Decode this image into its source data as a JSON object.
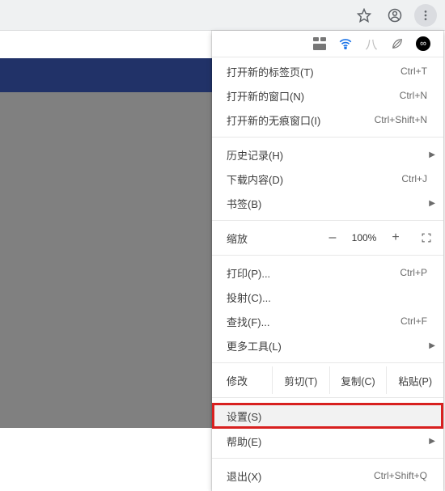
{
  "toolbar": {
    "icons": {
      "star": "star-icon",
      "account": "account-icon",
      "menu": "menu-icon"
    }
  },
  "extension_icons": [
    "apps",
    "wifi",
    "brush",
    "leaf",
    "infinity"
  ],
  "menu": {
    "group1": [
      {
        "label": "打开新的标签页(T)",
        "shortcut": "Ctrl+T"
      },
      {
        "label": "打开新的窗口(N)",
        "shortcut": "Ctrl+N"
      },
      {
        "label": "打开新的无痕窗口(I)",
        "shortcut": "Ctrl+Shift+N"
      }
    ],
    "group2": [
      {
        "label": "历史记录(H)",
        "submenu": true
      },
      {
        "label": "下载内容(D)",
        "shortcut": "Ctrl+J"
      },
      {
        "label": "书签(B)",
        "submenu": true
      }
    ],
    "zoom": {
      "label": "缩放",
      "minus": "–",
      "value": "100%",
      "plus": "+"
    },
    "group3": [
      {
        "label": "打印(P)...",
        "shortcut": "Ctrl+P"
      },
      {
        "label": "投射(C)..."
      },
      {
        "label": "查找(F)...",
        "shortcut": "Ctrl+F"
      },
      {
        "label": "更多工具(L)",
        "submenu": true
      }
    ],
    "edit": {
      "label": "修改",
      "cut": "剪切(T)",
      "copy": "复制(C)",
      "paste": "粘贴(P)"
    },
    "group4": [
      {
        "label": "设置(S)",
        "highlighted": true
      },
      {
        "label": "帮助(E)",
        "submenu": true
      }
    ],
    "group5": [
      {
        "label": "退出(X)",
        "shortcut": "Ctrl+Shift+Q"
      }
    ]
  }
}
